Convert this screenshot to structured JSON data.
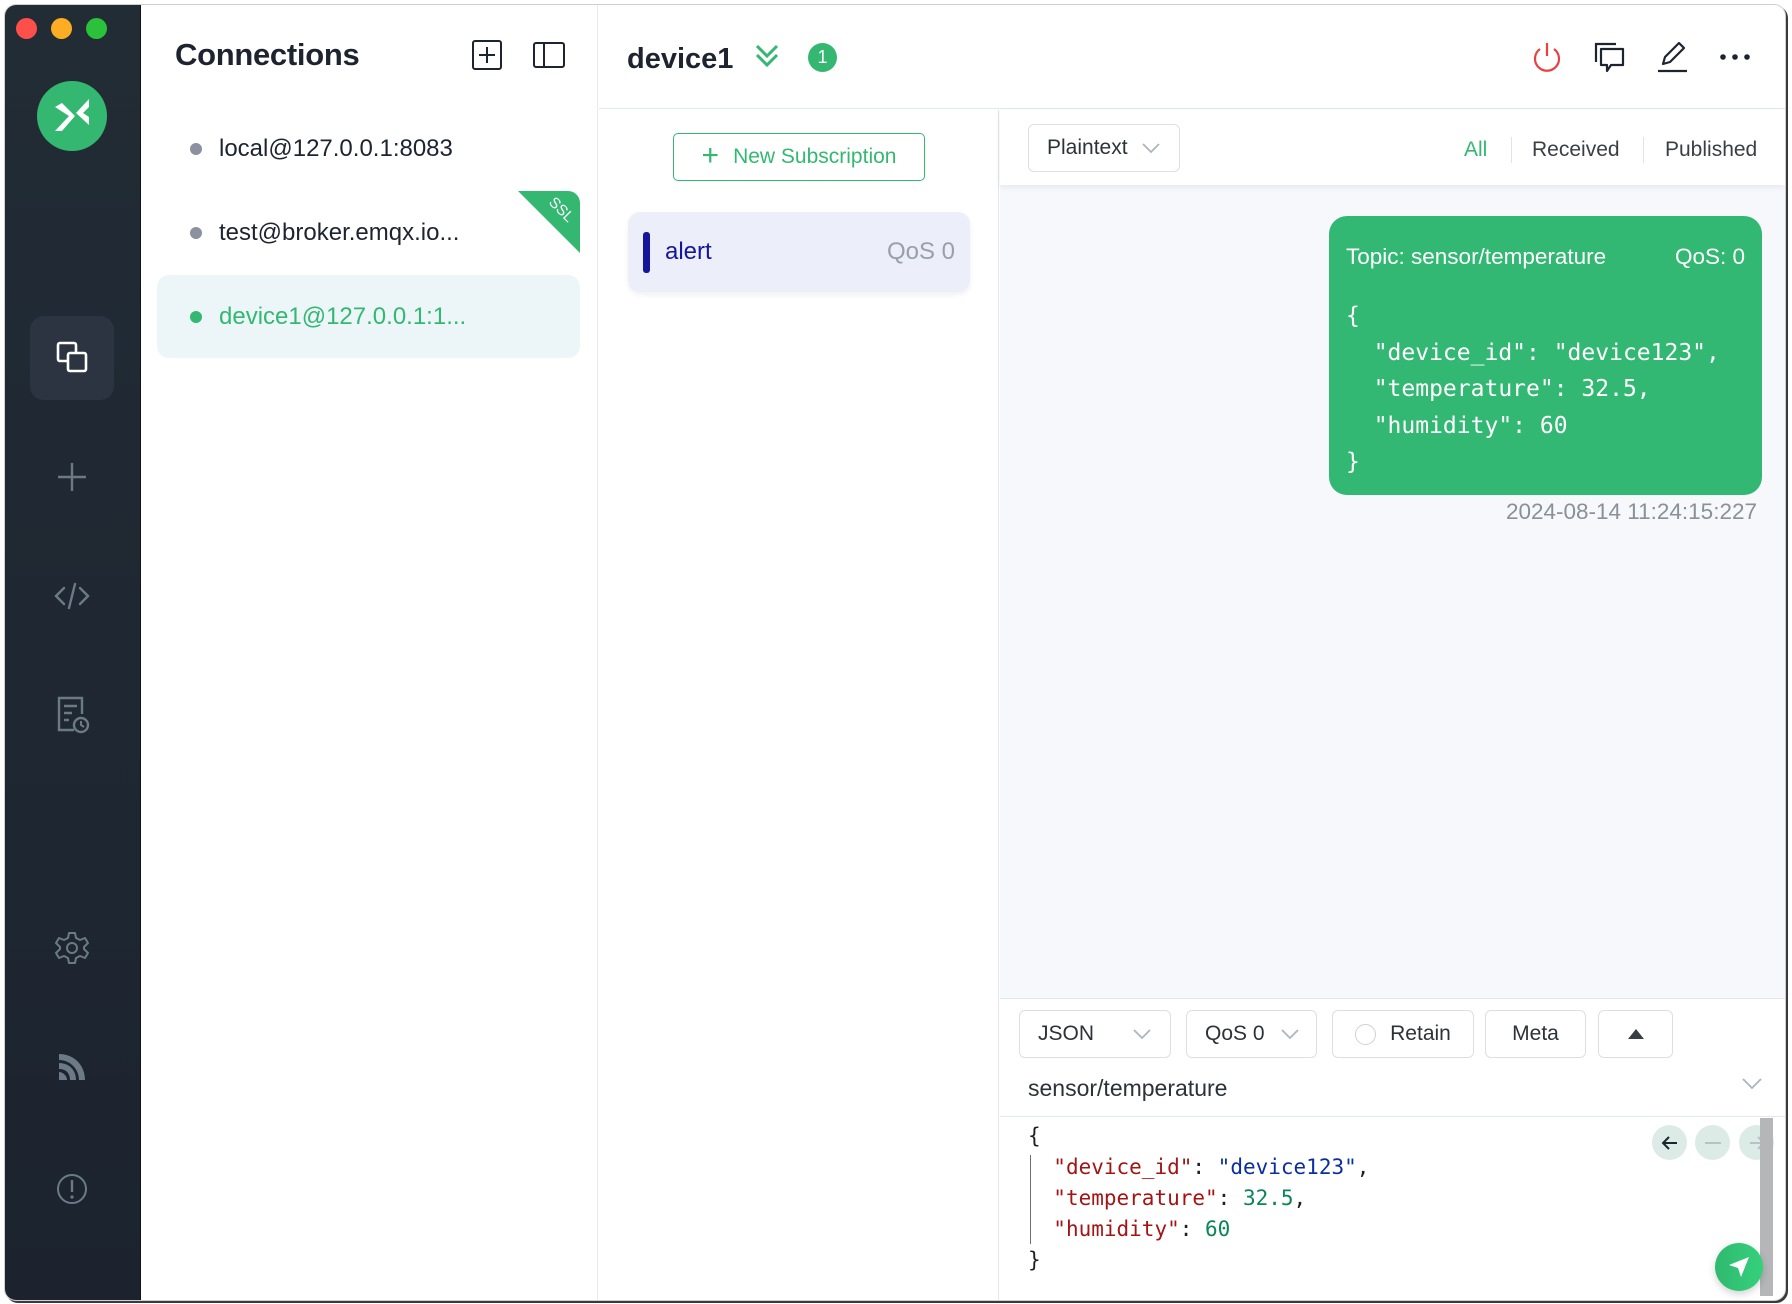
{
  "window": {
    "controls": [
      "close",
      "minimize",
      "zoom"
    ]
  },
  "sidebar": {
    "logo": "mqttx-logo",
    "items": [
      {
        "name": "connections",
        "icon": "connections-icon",
        "active": true
      },
      {
        "name": "new-connection",
        "icon": "plus-icon",
        "active": false
      },
      {
        "name": "script",
        "icon": "code-icon",
        "active": false
      },
      {
        "name": "log",
        "icon": "log-icon",
        "active": false
      }
    ],
    "bottom_items": [
      {
        "name": "settings",
        "icon": "gear-icon"
      },
      {
        "name": "subscribe-feed",
        "icon": "rss-icon"
      },
      {
        "name": "about",
        "icon": "info-icon"
      }
    ]
  },
  "connections": {
    "title": "Connections",
    "items": [
      {
        "label": "local@127.0.0.1:8083",
        "status": "disconnected",
        "ssl": false,
        "selected": false
      },
      {
        "label": "test@broker.emqx.io...",
        "status": "disconnected",
        "ssl": true,
        "ssl_label": "SSL",
        "selected": false
      },
      {
        "label": "device1@127.0.0.1:1...",
        "status": "connected",
        "ssl": false,
        "selected": true
      }
    ]
  },
  "header": {
    "connection_name": "device1",
    "message_count": "1",
    "actions": [
      "power-icon",
      "new-window-icon",
      "edit-icon",
      "more-icon"
    ]
  },
  "subscriptions": {
    "new_button_label": "New Subscription",
    "items": [
      {
        "topic": "alert",
        "qos": "QoS 0",
        "color": "#15169b"
      }
    ]
  },
  "messages": {
    "format_select": "Plaintext",
    "filters": [
      {
        "label": "All",
        "active": true
      },
      {
        "label": "Received",
        "active": false
      },
      {
        "label": "Published",
        "active": false
      }
    ],
    "list": [
      {
        "direction": "published",
        "topic_label": "Topic: sensor/temperature",
        "qos_label": "QoS: 0",
        "payload": "{\n  \"device_id\": \"device123\",\n  \"temperature\": 32.5,\n  \"humidity\": 60\n}",
        "timestamp": "2024-08-14 11:24:15:227"
      }
    ]
  },
  "publish": {
    "payload_format": "JSON",
    "qos": "QoS 0",
    "retain_label": "Retain",
    "retain": false,
    "meta_label": "Meta",
    "topic": "sensor/temperature",
    "topic_placeholder": "Topic",
    "payload_lines": [
      {
        "key": "\"device_id\"",
        "value": "\"device123\"",
        "type": "string",
        "comma": ","
      },
      {
        "key": "\"temperature\"",
        "value": "32.5",
        "type": "number",
        "comma": ","
      },
      {
        "key": "\"humidity\"",
        "value": "60",
        "type": "number",
        "comma": ""
      }
    ]
  },
  "colors": {
    "brand": "#34b871",
    "sidebar_bg": "#1f2731",
    "subscription_color": "#15169b",
    "disconnect": "#e94040"
  }
}
